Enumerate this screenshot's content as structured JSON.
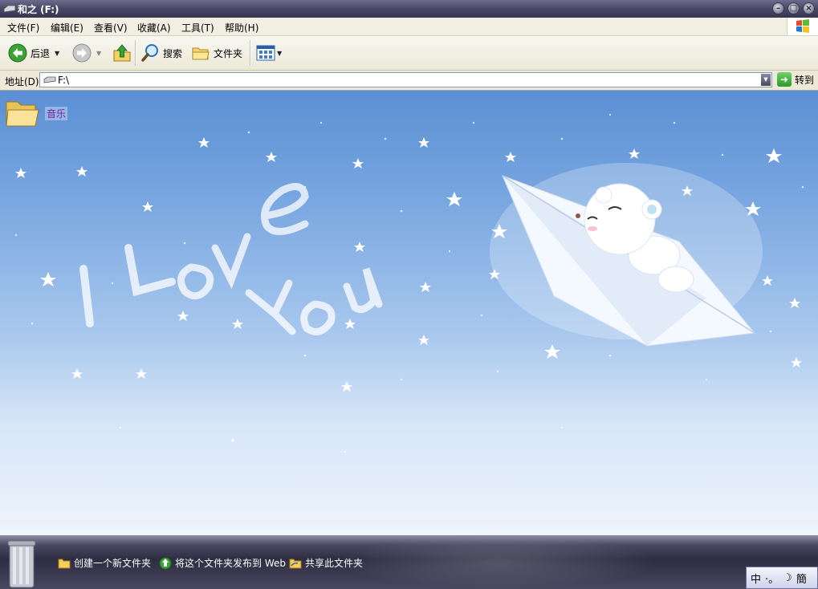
{
  "window": {
    "title": "和之 (F:)"
  },
  "menu": [
    "文件(F)",
    "编辑(E)",
    "查看(V)",
    "收藏(A)",
    "工具(T)",
    "帮助(H)"
  ],
  "toolbar": {
    "back": "后退",
    "search": "搜索",
    "folders": "文件夹"
  },
  "address": {
    "label": "地址(D)",
    "value": "F:\\",
    "go": "转到"
  },
  "files": [
    {
      "name": "音乐",
      "icon": "folder-icon"
    }
  ],
  "wallpaper_text": {
    "line1": "I Love",
    "line2": "You"
  },
  "tasks": [
    "创建一个新文件夹",
    "将这个文件夹发布到 Web",
    "共享此文件夹"
  ],
  "ime": {
    "mode": "中",
    "punct": "·。",
    "moon": "☽",
    "style": "簡"
  }
}
